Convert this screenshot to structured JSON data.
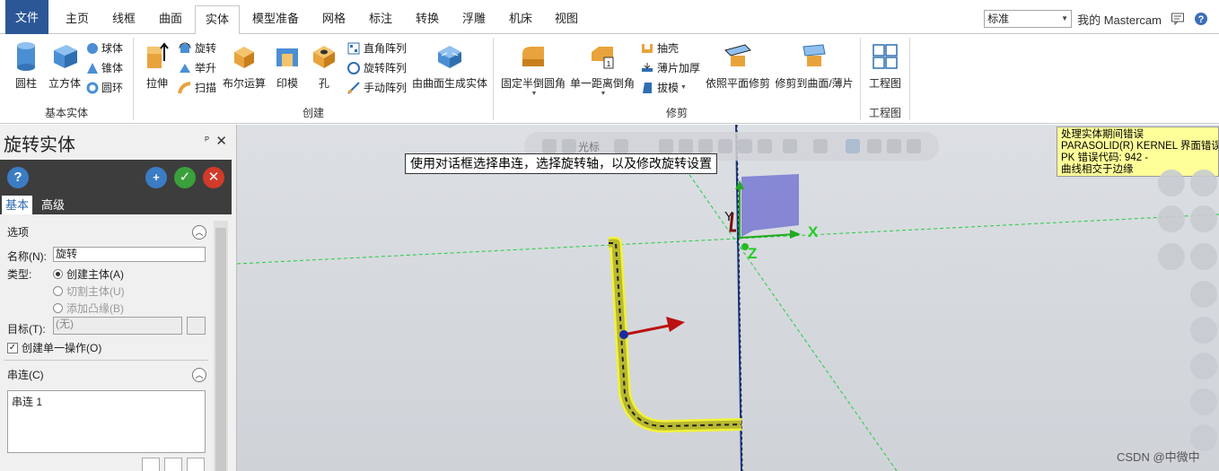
{
  "tabs": [
    "文件",
    "主页",
    "线框",
    "曲面",
    "实体",
    "模型准备",
    "网格",
    "标注",
    "转换",
    "浮雕",
    "机床",
    "视图"
  ],
  "active_tab": "实体",
  "top_right": {
    "style_value": "标准",
    "my_mastercam": "我的 Mastercam"
  },
  "ribbon": {
    "basic_solids": {
      "label": "基本实体",
      "cylinder": "圆柱",
      "box": "立方体",
      "sphere": "球体",
      "cone": "锥体",
      "torus": "圆环"
    },
    "create": {
      "label": "创建",
      "extrude": "拉伸",
      "revolve": "旋转",
      "loft": "举升",
      "sweep": "扫描",
      "boolean": "布尔运算",
      "impression": "印模",
      "hole": "孔",
      "rect_pattern": "直角阵列",
      "rot_pattern": "旋转阵列",
      "manual_pattern": "手动阵列",
      "from_surfaces": "由曲面生成实体"
    },
    "modify": {
      "label": "修剪",
      "const_fillet": "固定半倒圆角",
      "one_dist_chamfer": "单一距离倒角",
      "shell": "抽壳",
      "thicken": "薄片加厚",
      "draft": "拔模",
      "trim_plane": "依照平面修剪",
      "trim_surface": "修剪到曲面/薄片"
    },
    "drawing": {
      "label": "工程图",
      "drawing": "工程图"
    }
  },
  "panel": {
    "title": "旋转实体",
    "tabs": {
      "basic": "基本",
      "advanced": "高级"
    },
    "options": {
      "header": "选项",
      "name_label": "名称(N):",
      "name_value": "旋转",
      "type_label": "类型:",
      "type_create": "创建主体(A)",
      "type_cut": "切割主体(U)",
      "type_boss": "添加凸缘(B)",
      "target_label": "目标(T):",
      "target_value": "(无)",
      "single_op": "创建单一操作(O)"
    },
    "chains": {
      "header": "串连(C)",
      "items": [
        "串连 1"
      ]
    }
  },
  "viewport": {
    "selection_mode": "光标",
    "tooltip": "使用对话框选择串连，选择旋转轴，以及修改旋转设置",
    "error": [
      "处理实体期间错误",
      "PARASOLID(R) KERNEL 界面错误：",
      "PK 错误代码: 942 -",
      "曲线相交于边缘"
    ],
    "axis_x": "X",
    "axis_y": "Y",
    "axis_z": "Z",
    "watermark": "CSDN @中微中"
  },
  "colors": {
    "file_tab": "#2b5797",
    "chain_highlight": "#f2f23a",
    "grid_line": "#22cc44",
    "axis_blue": "#1a3a8a",
    "arrow_red": "#cc1111",
    "error_bg": "#ffff99"
  }
}
